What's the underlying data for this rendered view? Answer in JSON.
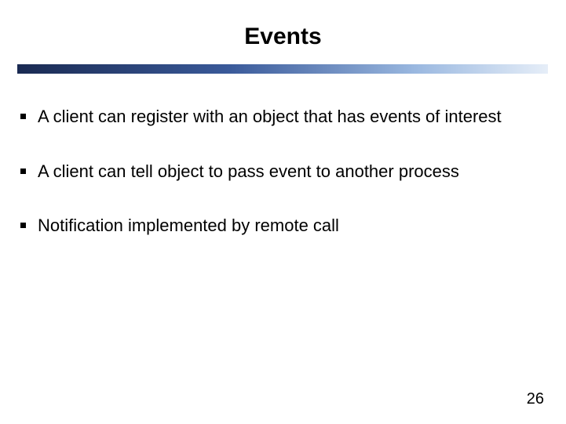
{
  "slide": {
    "title": "Events",
    "bullets": [
      "A client can register with an object that has events of interest",
      "A client can tell object to pass event to another process",
      "Notification implemented by remote call"
    ],
    "page_number": "26"
  }
}
